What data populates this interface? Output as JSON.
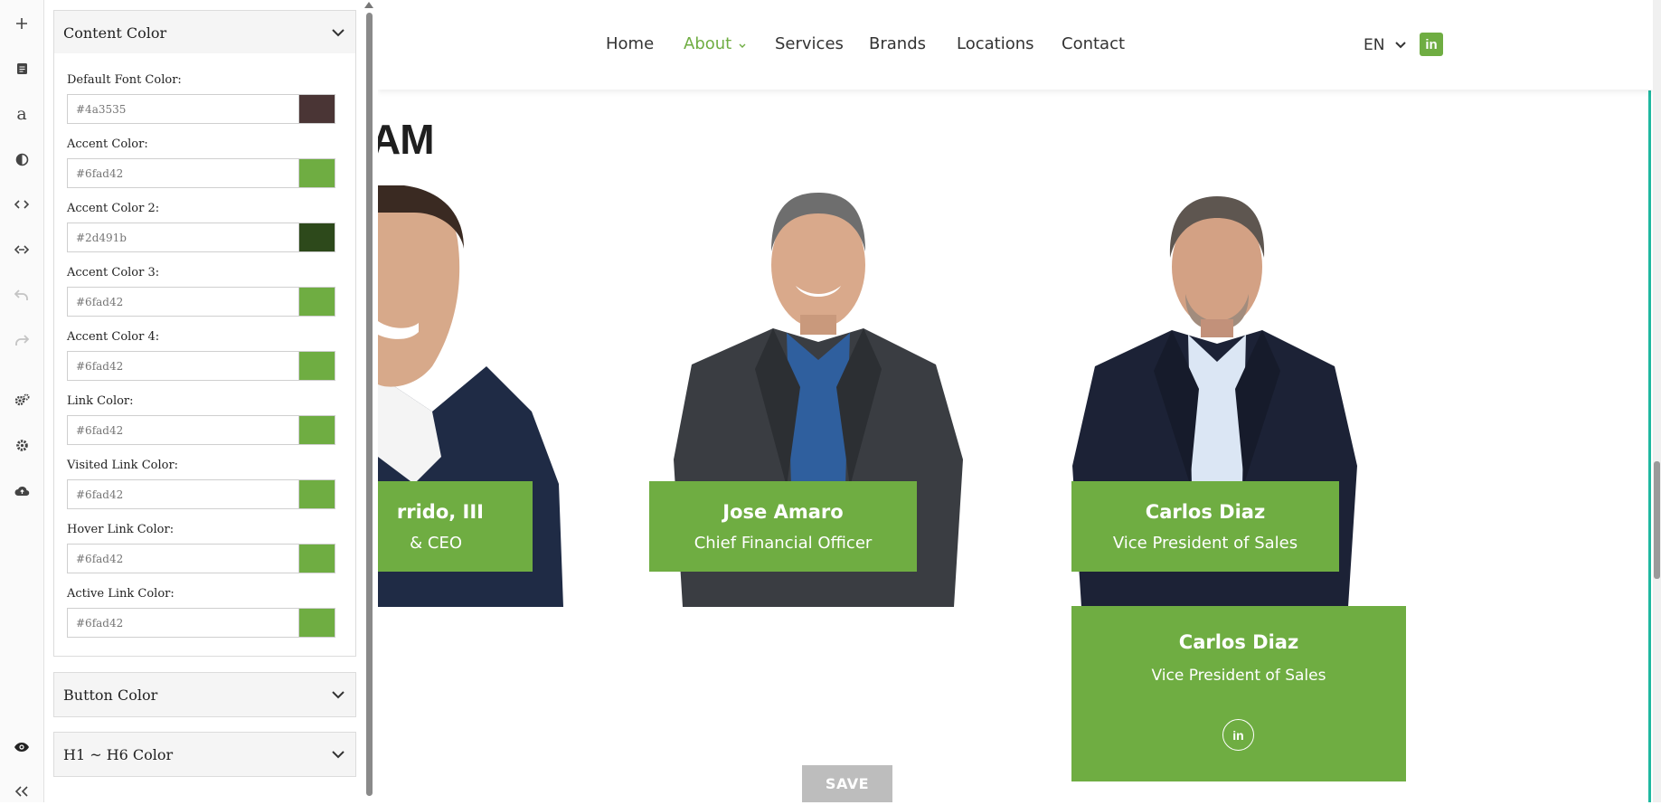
{
  "rail": {
    "icons": [
      "plus-icon",
      "page-icon",
      "font-icon",
      "contrast-icon",
      "code-icon",
      "embed-icon",
      "undo-icon",
      "redo-icon",
      "cogs-icon",
      "settings-icon",
      "cloud-upload-icon"
    ],
    "bottom_icons": [
      "eye-icon",
      "collapse-icon"
    ]
  },
  "panel": {
    "open_section": {
      "title": "Content Color",
      "fields": [
        {
          "label": "Default Font Color:",
          "value": "#4a3535",
          "color": "#4a3535"
        },
        {
          "label": "Accent Color:",
          "value": "#6fad42",
          "color": "#6fad42"
        },
        {
          "label": "Accent Color 2:",
          "value": "#2d491b",
          "color": "#2d491b"
        },
        {
          "label": "Accent Color 3:",
          "value": "#6fad42",
          "color": "#6fad42"
        },
        {
          "label": "Accent Color 4:",
          "value": "#6fad42",
          "color": "#6fad42"
        },
        {
          "label": "Link Color:",
          "value": "#6fad42",
          "color": "#6fad42"
        },
        {
          "label": "Visited Link Color:",
          "value": "#6fad42",
          "color": "#6fad42"
        },
        {
          "label": "Hover Link Color:",
          "value": "#6fad42",
          "color": "#6fad42"
        },
        {
          "label": "Active Link Color:",
          "value": "#6fad42",
          "color": "#6fad42"
        }
      ]
    },
    "collapsed_sections": [
      "Button Color",
      "H1 ~ H6 Color"
    ]
  },
  "site": {
    "nav": [
      "Home",
      "About",
      "Services",
      "Brands",
      "Locations",
      "Contact"
    ],
    "active_nav": "About",
    "lang": "EN",
    "linkedin_label": "in",
    "heading": "AM",
    "members": [
      {
        "name": "rrido, III",
        "title": "& CEO"
      },
      {
        "name": "Jose Amaro",
        "title": "Chief Financial Officer"
      },
      {
        "name": "Carlos Diaz",
        "title": "Vice President of Sales"
      }
    ],
    "hover_card": {
      "name": "Carlos Diaz",
      "title": "Vice President of Sales",
      "linkedin": "in"
    },
    "save_label": "SAVE",
    "accent": "#6fad42"
  }
}
